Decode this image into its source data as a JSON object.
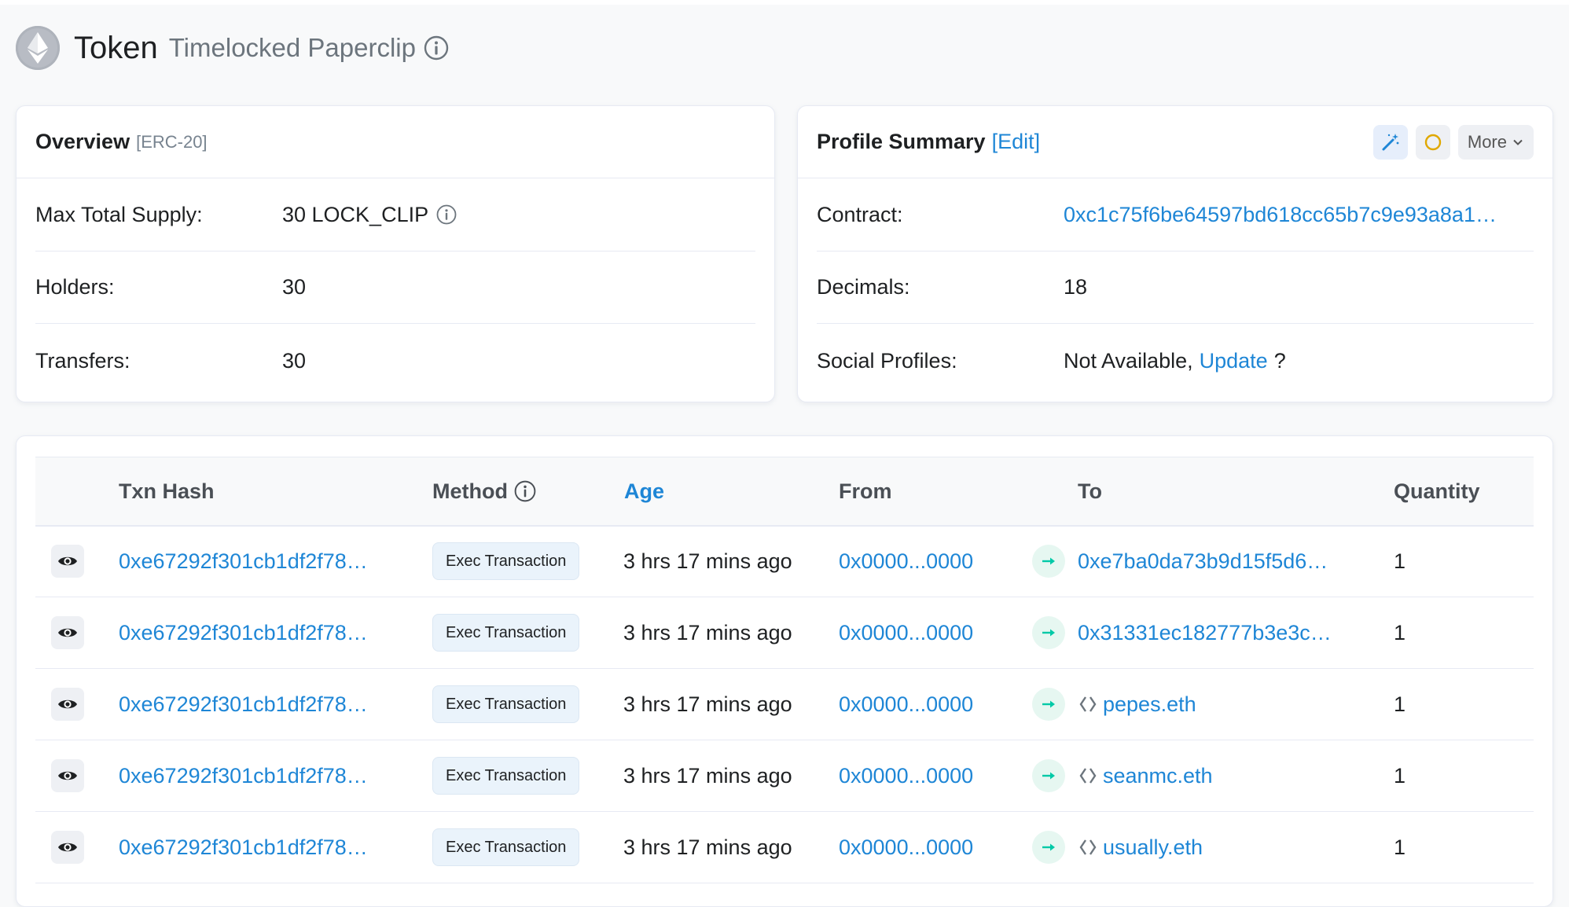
{
  "header": {
    "title": "Token",
    "subtitle": "Timelocked Paperclip",
    "icons": [
      "ethereum-logo-icon",
      "info-icon"
    ]
  },
  "overview": {
    "title": "Overview",
    "tag": "[ERC-20]",
    "rows": [
      {
        "label": "Max Total Supply:",
        "value": "30 LOCK_CLIP"
      },
      {
        "label": "Holders:",
        "value": "30"
      },
      {
        "label": "Transfers:",
        "value": "30"
      }
    ]
  },
  "profile": {
    "title": "Profile Summary",
    "edit_label": "[Edit]",
    "more_label": "More",
    "contract_label": "Contract:",
    "contract_value": "0xc1c75f6be64597bd618cc65b7c9e93a8a1…",
    "decimals_label": "Decimals:",
    "decimals_value": "18",
    "social_label": "Social Profiles:",
    "social_value": "Not Available,",
    "social_update": "Update",
    "social_question": "?"
  },
  "table": {
    "headers": {
      "txn_hash": "Txn Hash",
      "method": "Method",
      "age": "Age",
      "from": "From",
      "to": "To",
      "quantity": "Quantity"
    },
    "rows": [
      {
        "hash": "0xe67292f301cb1df2f78…",
        "method": "Exec Transaction",
        "age": "3 hrs 17 mins ago",
        "from": "0x0000...0000",
        "to": "0xe7ba0da73b9d15f5d6…",
        "to_is_ens": false,
        "qty": "1"
      },
      {
        "hash": "0xe67292f301cb1df2f78…",
        "method": "Exec Transaction",
        "age": "3 hrs 17 mins ago",
        "from": "0x0000...0000",
        "to": "0x31331ec182777b3e3c…",
        "to_is_ens": false,
        "qty": "1"
      },
      {
        "hash": "0xe67292f301cb1df2f78…",
        "method": "Exec Transaction",
        "age": "3 hrs 17 mins ago",
        "from": "0x0000...0000",
        "to": "pepes.eth",
        "to_is_ens": true,
        "qty": "1"
      },
      {
        "hash": "0xe67292f301cb1df2f78…",
        "method": "Exec Transaction",
        "age": "3 hrs 17 mins ago",
        "from": "0x0000...0000",
        "to": "seanmc.eth",
        "to_is_ens": true,
        "qty": "1"
      },
      {
        "hash": "0xe67292f301cb1df2f78…",
        "method": "Exec Transaction",
        "age": "3 hrs 17 mins ago",
        "from": "0x0000...0000",
        "to": "usually.eth",
        "to_is_ens": true,
        "qty": "1"
      }
    ]
  },
  "colors": {
    "link": "#1e86d6",
    "background": "#f8f9fa",
    "arrow_green": "#00c9a7",
    "muted": "#6c757d"
  }
}
